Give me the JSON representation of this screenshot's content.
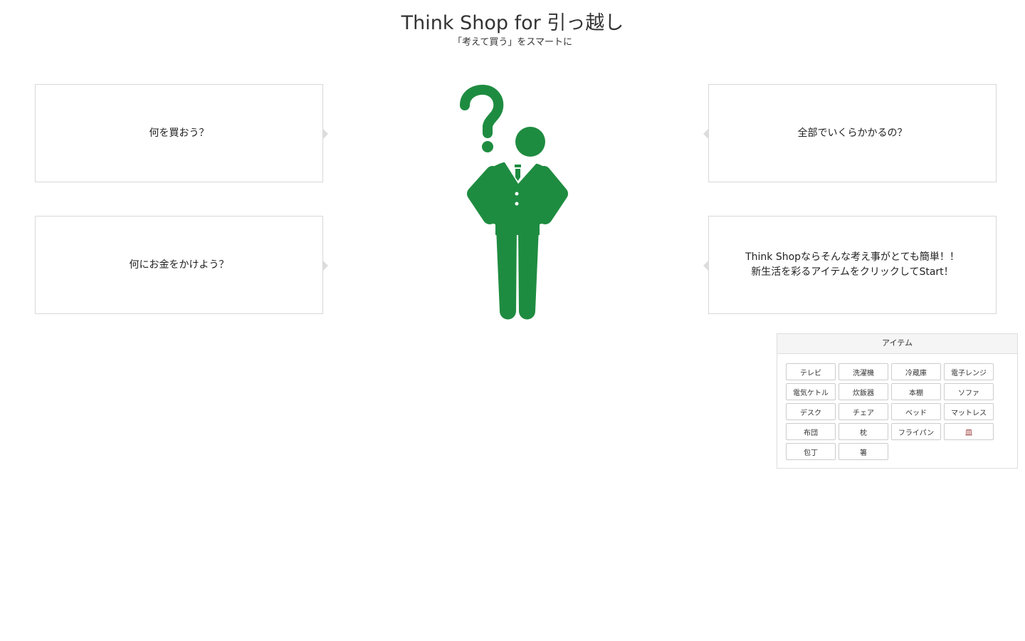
{
  "header": {
    "title": "Think Shop for 引っ越し",
    "subtitle": "「考えて買う」をスマートに"
  },
  "bubbles": {
    "q1": "何を買おう？",
    "q2": "何にお金をかけよう？",
    "q3": "全部でいくらかかるの？",
    "q4_line1": "Think Shopならそんな考え事がとても簡単！！",
    "q4_line2": "新生活を彩るアイテムをクリックしてStart！"
  },
  "figure": {
    "icon": "thinking-person-icon",
    "color": "#1e8c40"
  },
  "items_panel": {
    "title": "アイテム",
    "items": [
      "テレビ",
      "洗濯機",
      "冷蔵庫",
      "電子レンジ",
      "電気ケトル",
      "炊飯器",
      "本棚",
      "ソファ",
      "デスク",
      "チェア",
      "ベッド",
      "マットレス",
      "布団",
      "枕",
      "フライパン",
      "皿",
      "包丁",
      "箸"
    ],
    "highlight_item": "皿",
    "highlight_color": "#8b1a1a"
  }
}
